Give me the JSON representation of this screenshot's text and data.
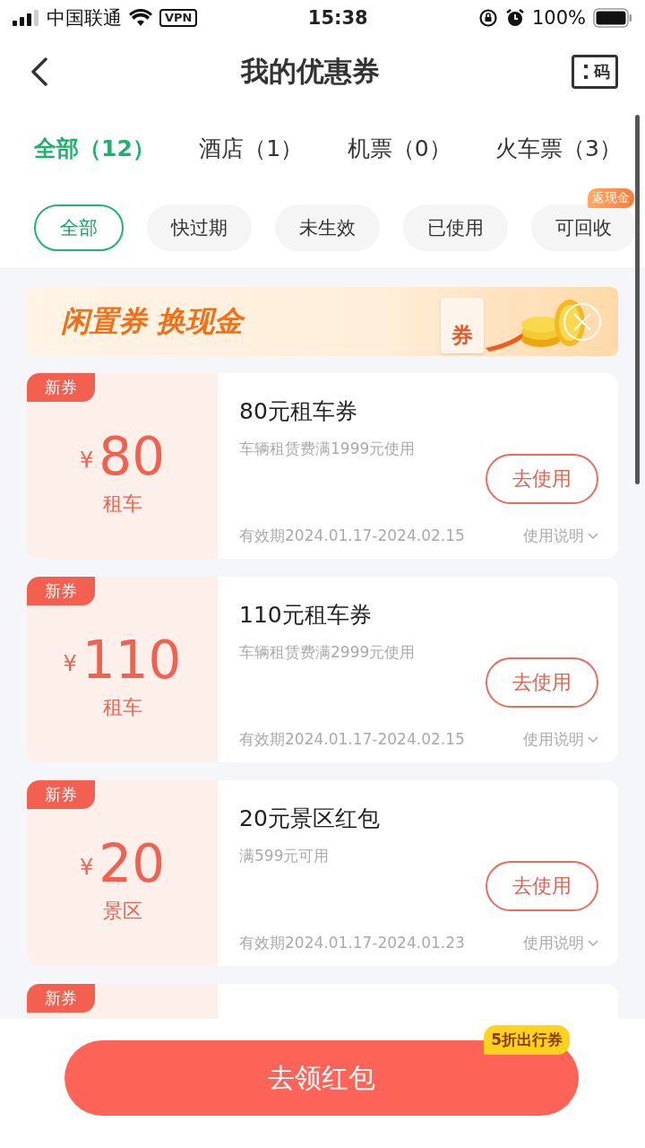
{
  "status_bar": {
    "carrier": "中国联通",
    "vpn": "VPN",
    "time": "15:38",
    "battery": "100%"
  },
  "header": {
    "title": "我的优惠券",
    "code_label": "码"
  },
  "tabs": [
    {
      "label": "全部（12）",
      "selected": true
    },
    {
      "label": "酒店（1）",
      "selected": false
    },
    {
      "label": "机票（0）",
      "selected": false
    },
    {
      "label": "火车票（3）",
      "selected": false
    }
  ],
  "filters": [
    {
      "label": "全部",
      "selected": true
    },
    {
      "label": "快过期",
      "selected": false
    },
    {
      "label": "未生效",
      "selected": false
    },
    {
      "label": "已使用",
      "selected": false
    },
    {
      "label": "可回收",
      "selected": false,
      "badge": "返现金"
    }
  ],
  "banner": {
    "text": "闲置券 换现金",
    "ticket_label": "券"
  },
  "coupons": [
    {
      "badge": "新券",
      "currency": "¥",
      "amount": "80",
      "category": "租车",
      "title": "80元租车券",
      "condition": "车辆租赁费满1999元使用",
      "action": "去使用",
      "validity": "有效期2024.01.17-2024.02.15",
      "details": "使用说明"
    },
    {
      "badge": "新券",
      "currency": "¥",
      "amount": "110",
      "category": "租车",
      "title": "110元租车券",
      "condition": "车辆租赁费满2999元使用",
      "action": "去使用",
      "validity": "有效期2024.01.17-2024.02.15",
      "details": "使用说明"
    },
    {
      "badge": "新券",
      "currency": "¥",
      "amount": "20",
      "category": "景区",
      "title": "20元景区红包",
      "condition": "满599元可用",
      "action": "去使用",
      "validity": "有效期2024.01.17-2024.01.23",
      "details": "使用说明"
    },
    {
      "badge": "新券"
    }
  ],
  "bottom": {
    "button": "去领红包",
    "badge": "5折出行券"
  }
}
